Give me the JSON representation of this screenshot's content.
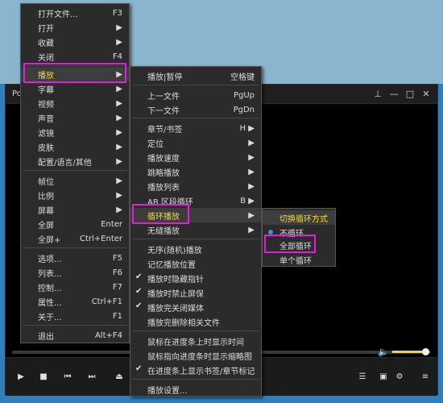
{
  "player": {
    "title": "Po",
    "controls": {
      "play": "play-icon",
      "stop": "stop-icon",
      "prev": "previous-icon",
      "next": "next-icon",
      "eject": "eject-icon",
      "playlist": "playlist-icon",
      "capture": "capture-icon",
      "settings": "gear-icon",
      "menu": "hamburger-icon"
    },
    "volume_level": 0.9
  },
  "main_menu": {
    "items": [
      {
        "label": "打开文件...",
        "shortcut": "F3"
      },
      {
        "label": "打开",
        "shortcut": "▶"
      },
      {
        "label": "收藏",
        "shortcut": "▶"
      },
      {
        "label": "关闭",
        "shortcut": "F4"
      },
      {
        "label": "播放",
        "shortcut": "▶"
      },
      {
        "label": "字幕",
        "shortcut": "▶"
      },
      {
        "label": "视频",
        "shortcut": "▶"
      },
      {
        "label": "声音",
        "shortcut": "▶"
      },
      {
        "label": "滤镜",
        "shortcut": "▶"
      },
      {
        "label": "皮肤",
        "shortcut": "▶"
      },
      {
        "label": "配置/语言/其他",
        "shortcut": "▶"
      },
      {
        "label": "帧位",
        "shortcut": "▶"
      },
      {
        "label": "比例",
        "shortcut": "▶"
      },
      {
        "label": "屏幕",
        "shortcut": "▶"
      },
      {
        "label": "全屏",
        "shortcut": "Enter"
      },
      {
        "label": "全屏+",
        "shortcut": "Ctrl+Enter"
      },
      {
        "label": "选项...",
        "shortcut": "F5"
      },
      {
        "label": "列表...",
        "shortcut": "F6"
      },
      {
        "label": "控制...",
        "shortcut": "F7"
      },
      {
        "label": "属性...",
        "shortcut": "Ctrl+F1"
      },
      {
        "label": "关于...",
        "shortcut": "F1"
      },
      {
        "label": "退出",
        "shortcut": "Alt+F4"
      }
    ]
  },
  "play_menu": {
    "items": [
      {
        "label": "播放|暂停",
        "shortcut": "空格键"
      },
      {
        "label": "上一文件",
        "shortcut": "PgUp"
      },
      {
        "label": "下一文件",
        "shortcut": "PgDn"
      },
      {
        "label": "章节/书签",
        "shortcut": "H ▶"
      },
      {
        "label": "定位",
        "shortcut": "▶"
      },
      {
        "label": "播放速度",
        "shortcut": "▶"
      },
      {
        "label": "跳略播放",
        "shortcut": "▶"
      },
      {
        "label": "播放列表",
        "shortcut": "▶"
      },
      {
        "label": "AB 区段循环",
        "shortcut": "B ▶"
      },
      {
        "label": "循环播放",
        "shortcut": "▶"
      },
      {
        "label": "无缝播放",
        "shortcut": "▶"
      },
      {
        "label": "无序(随机)播放",
        "shortcut": ""
      },
      {
        "label": "记忆播放位置",
        "shortcut": ""
      },
      {
        "label": "播放时隐藏指针",
        "shortcut": ""
      },
      {
        "label": "播放时禁止屏保",
        "shortcut": ""
      },
      {
        "label": "播放完关闭媒体",
        "shortcut": ""
      },
      {
        "label": "播放完删除相关文件",
        "shortcut": ""
      },
      {
        "label": "鼠标在进度条上时显示时间",
        "shortcut": ""
      },
      {
        "label": "鼠标指向进度条时显示缩略图",
        "shortcut": ""
      },
      {
        "label": "在进度条上显示书签/章节标记",
        "shortcut": ""
      },
      {
        "label": "播放设置...",
        "shortcut": ""
      }
    ],
    "checkmark": "✔"
  },
  "loop_menu": {
    "header": "切换循环方式",
    "items": [
      {
        "label": "不循环"
      },
      {
        "label": "全部循环"
      },
      {
        "label": "单个循环"
      }
    ]
  },
  "colors": {
    "highlight_text": "#f5d93a",
    "annotation_box": "#e020d8",
    "menu_bg": "#2b2b2b"
  }
}
